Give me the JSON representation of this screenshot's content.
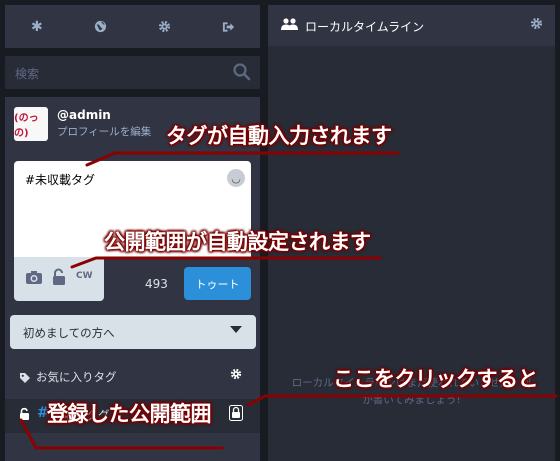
{
  "navbar": {
    "items": [
      "asterisk-icon",
      "globe-icon",
      "gear-icon",
      "sign-out-icon"
    ]
  },
  "search": {
    "placeholder": "検索"
  },
  "profile": {
    "avatar_text": "(のっの)",
    "username": "@admin",
    "edit_link": "プロフィールを編集"
  },
  "compose": {
    "text": "#未収載タグ",
    "char_count": "493",
    "toot_label": "トゥート",
    "cw_label": "CW"
  },
  "privacy_select": {
    "value": "初めましての方へ"
  },
  "favourite_tags": {
    "title": "お気に入りタグ",
    "items": [
      {
        "tag": "未収載タグ",
        "hash": "#"
      }
    ]
  },
  "column": {
    "title": "ローカルタイムライン",
    "empty_message": "ローカルタイムラインはまだ使われていません。何か書いてみましょう!"
  },
  "annotations": {
    "tag_auto": "タグが自動入力されます",
    "visibility_auto": "公開範囲が自動設定されます",
    "click_here": "ここをクリックすると",
    "registered_visibility": "登録した公開範囲"
  },
  "colors": {
    "accent": "#2b90d9",
    "annotation_line": "#8b0000",
    "background": "#191b22",
    "panel": "#313543"
  }
}
